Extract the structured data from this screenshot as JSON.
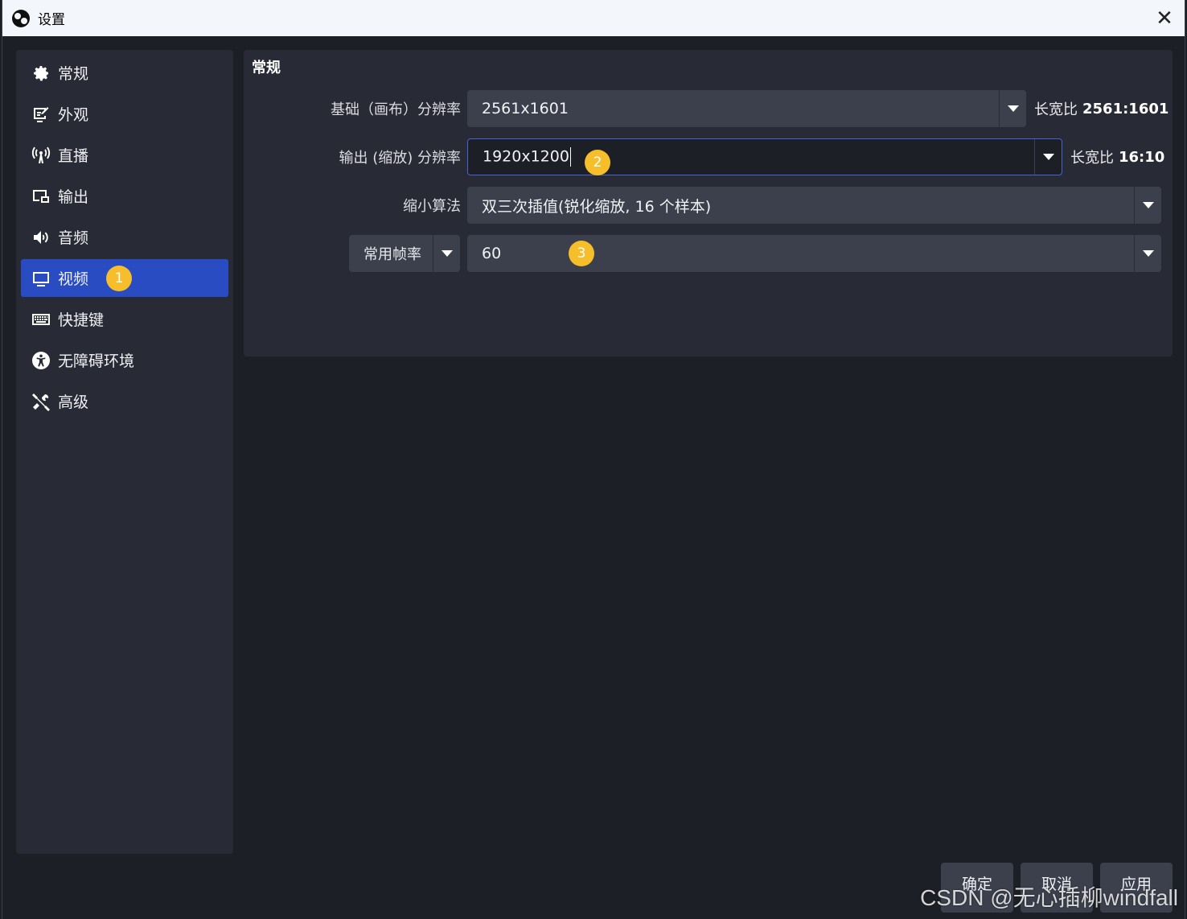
{
  "window": {
    "title": "设置"
  },
  "sidebar": {
    "items": [
      {
        "label": "常规",
        "icon": "gear-icon"
      },
      {
        "label": "外观",
        "icon": "appearance-icon"
      },
      {
        "label": "直播",
        "icon": "antenna-icon"
      },
      {
        "label": "输出",
        "icon": "output-icon"
      },
      {
        "label": "音频",
        "icon": "speaker-icon"
      },
      {
        "label": "视频",
        "icon": "monitor-icon",
        "active": true
      },
      {
        "label": "快捷键",
        "icon": "keyboard-icon"
      },
      {
        "label": "无障碍环境",
        "icon": "accessibility-icon"
      },
      {
        "label": "高级",
        "icon": "tools-icon"
      }
    ]
  },
  "panel": {
    "title": "常规",
    "base_resolution": {
      "label": "基础（画布）分辨率",
      "value": "2561x1601",
      "aspect_label": "长宽比",
      "aspect_value": "2561:1601"
    },
    "output_resolution": {
      "label": "输出 (缩放) 分辨率",
      "value": "1920x1200",
      "aspect_label": "长宽比",
      "aspect_value": "16:10"
    },
    "downscale": {
      "label": "缩小算法",
      "value": "双三次插值(锐化缩放, 16 个样本)"
    },
    "fps": {
      "type_value": "常用帧率",
      "value": "60"
    }
  },
  "markers": [
    "1",
    "2",
    "3"
  ],
  "buttons": {
    "ok": "确定",
    "cancel": "取消",
    "apply": "应用"
  },
  "watermark": "CSDN @无心插柳windfall",
  "colors": {
    "accent": "#2a4cc3",
    "marker": "#f5be2a",
    "panel": "#282b35",
    "background": "#1d1f26"
  }
}
